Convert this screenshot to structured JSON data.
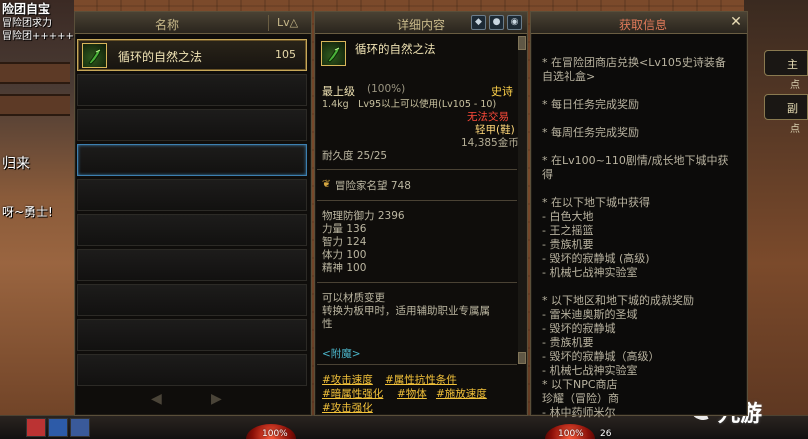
{
  "background": {
    "name_tags": [
      "险团自宝",
      "冒险团求力",
      "冒险团++++++",
      "归来",
      "呀~勇士!"
    ],
    "side_buttons": [
      "主",
      "点",
      "副",
      "点"
    ],
    "orb_left": "100%",
    "orb_right": "100%",
    "orb_level": "26",
    "watermark": "九游"
  },
  "list_panel": {
    "col_name": "名称",
    "col_lv": "Lv△",
    "items": [
      {
        "name": "循环的自然之法",
        "lv": "105"
      }
    ],
    "prev_arrow": "◀",
    "next_arrow": "▶"
  },
  "detail_panel": {
    "title": "详细内容",
    "item_name": "循环的自然之法",
    "grade": "最上级",
    "grade_pct": "(100%)",
    "rarity": "史诗",
    "weight_req": "1.4kg　Lv95以上可以使用(Lv105 - 10)",
    "trade": "无法交易",
    "armor_type": "轻甲(鞋)",
    "price": "14,385金币",
    "durability": "耐久度 25/25",
    "reputation": "冒险家名望 748",
    "stats": [
      "物理防御力 2396",
      "力量 136",
      "智力 124",
      "体力 100",
      "精神 100"
    ],
    "change_lines": [
      "可以材质变更",
      "转换为板甲时，适用辅助职业专属属",
      "性"
    ],
    "enchant": "<附魔>",
    "tags": [
      "#攻击速度",
      "#属性抗性条件",
      "#暗属性强化",
      "#物体",
      "#施放速度",
      "#攻击强化"
    ]
  },
  "source_panel": {
    "title": "获取信息",
    "close": "✕",
    "lines": [
      "* 在冒险团商店兑换<Lv105史诗装备",
      "自选礼盒>",
      "* 每日任务完成奖励",
      "* 每周任务完成奖励",
      "* 在Lv100~110剧情/成长地下城中获",
      "得",
      "* 在以下地下城中获得",
      "- 白色大地",
      "- 王之摇篮",
      "- 贵族机要",
      "- 毁坏的寂静城 (高级)",
      "- 机械七战神实验室",
      "* 以下地区和地下城的成就奖励",
      "- 雷米迪奥斯的圣域",
      "- 毁坏的寂静城",
      "- 贵族机要",
      "- 毁坏的寂静城（高级）",
      "- 机械七战神实验室",
      "* 以下NPC商店",
      "珍耀（冒险）商",
      "- 林中药师米尔"
    ]
  },
  "colors": {
    "gold": "#f3c23a",
    "epic": "#ffd24a",
    "untradeable": "#ff4a3a",
    "armor": "#ffd87a",
    "highlight": "#c7a85a",
    "focus": "#3d7fb0"
  }
}
